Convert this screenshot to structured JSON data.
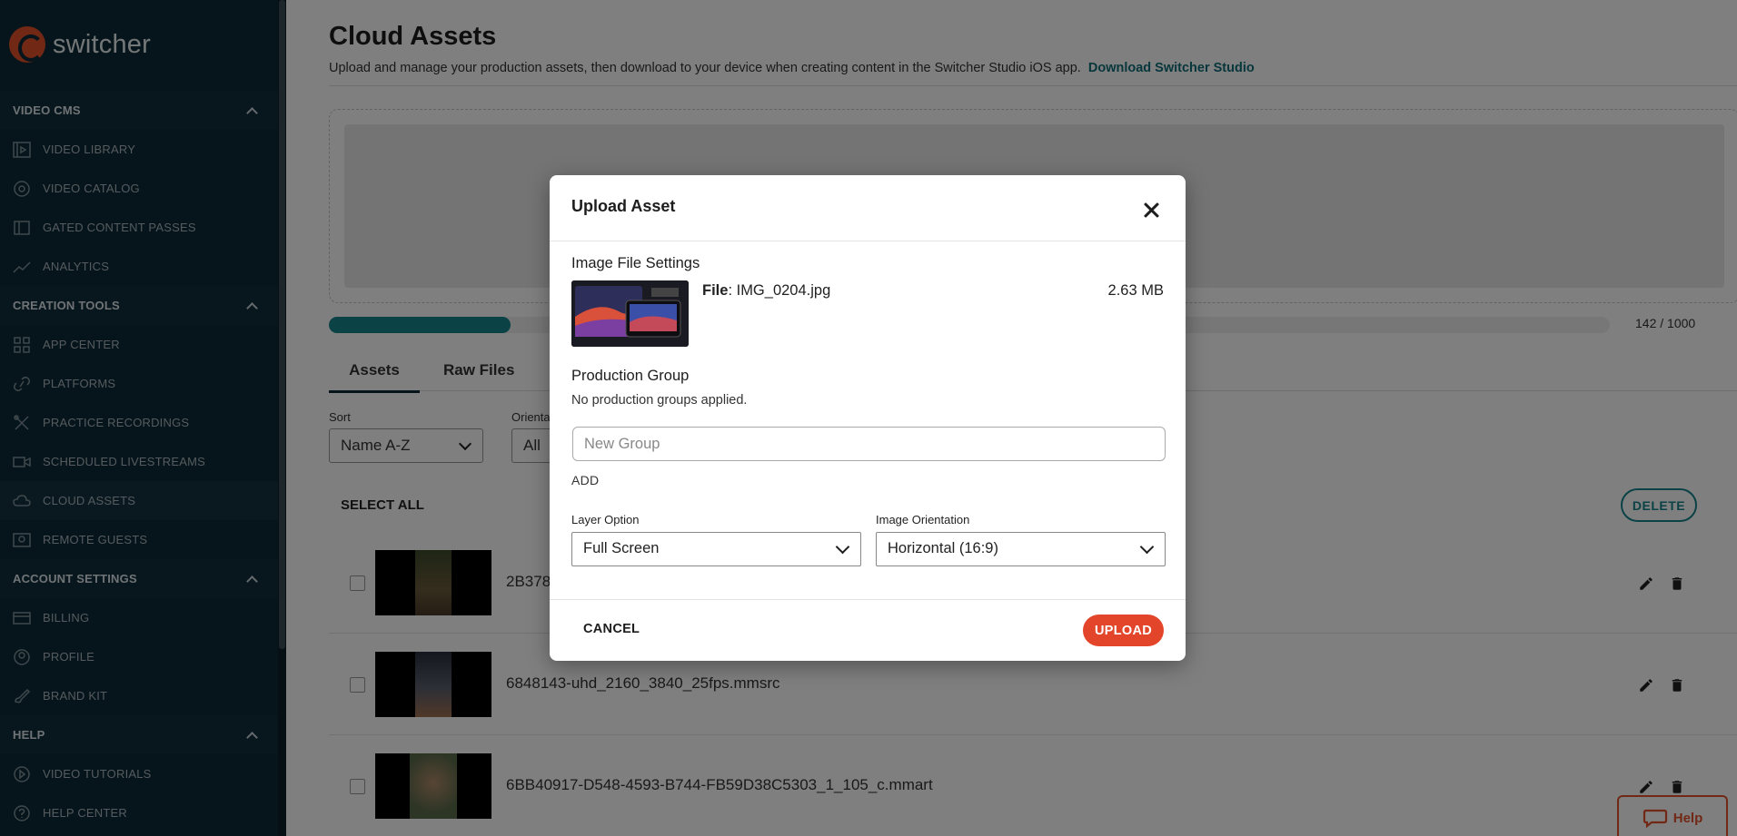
{
  "sidebar": {
    "logo_text": "switcher",
    "sections": [
      {
        "title": "VIDEO CMS",
        "items": [
          {
            "label": "VIDEO LIBRARY",
            "icon": "video-library-icon"
          },
          {
            "label": "VIDEO CATALOG",
            "icon": "catalog-icon"
          },
          {
            "label": "GATED CONTENT PASSES",
            "icon": "ticket-icon"
          },
          {
            "label": "ANALYTICS",
            "icon": "chart-icon"
          }
        ]
      },
      {
        "title": "CREATION TOOLS",
        "items": [
          {
            "label": "APP CENTER",
            "icon": "grid-icon"
          },
          {
            "label": "PLATFORMS",
            "icon": "link-icon"
          },
          {
            "label": "PRACTICE RECORDINGS",
            "icon": "tools-icon"
          },
          {
            "label": "SCHEDULED LIVESTREAMS",
            "icon": "camera-icon"
          },
          {
            "label": "CLOUD ASSETS",
            "icon": "cloud-icon",
            "active": true
          },
          {
            "label": "REMOTE GUESTS",
            "icon": "guests-icon"
          }
        ]
      },
      {
        "title": "ACCOUNT SETTINGS",
        "items": [
          {
            "label": "BILLING",
            "icon": "card-icon"
          },
          {
            "label": "PROFILE",
            "icon": "profile-icon"
          },
          {
            "label": "BRAND KIT",
            "icon": "brush-icon"
          }
        ]
      },
      {
        "title": "HELP",
        "items": [
          {
            "label": "VIDEO TUTORIALS",
            "icon": "play-circle-icon"
          },
          {
            "label": "HELP CENTER",
            "icon": "question-icon"
          }
        ]
      }
    ]
  },
  "page": {
    "title": "Cloud Assets",
    "subtitle": "Upload and manage your production assets, then download to your device when creating content in the Switcher Studio iOS app.",
    "subtitle_link": "Download Switcher Studio",
    "progress": {
      "count_text": "142 / 1000",
      "fraction": 0.142
    },
    "tabs": [
      "Assets",
      "Raw Files"
    ],
    "sort_label": "Sort",
    "sort_value": "Name A-Z",
    "orientation_label": "Orienta",
    "orientation_value": "All",
    "select_all": "SELECT ALL",
    "delete_label": "DELETE",
    "assets": [
      {
        "name": "2B378"
      },
      {
        "name": "6848143-uhd_2160_3840_25fps.mmsrc"
      },
      {
        "name": "6BB40917-D548-4593-B744-FB59D38C5303_1_105_c.mmart"
      }
    ],
    "help_label": "Help"
  },
  "modal": {
    "title": "Upload Asset",
    "file_settings_heading": "Image File Settings",
    "file_label": "File",
    "file_name": ": IMG_0204.jpg",
    "file_size": "2.63 MB",
    "production_group_heading": "Production Group",
    "no_groups_text": "No production groups applied.",
    "group_placeholder": "New Group",
    "add_label": "ADD",
    "layer_option_label": "Layer Option",
    "layer_option_value": "Full Screen",
    "image_orientation_label": "Image Orientation",
    "image_orientation_value": "Horizontal (16:9)",
    "cancel_label": "CANCEL",
    "upload_label": "UPLOAD"
  },
  "colors": {
    "sidebar_bg": "#0d2a36",
    "accent_teal": "#15858d",
    "accent_orange": "#e3452a"
  }
}
